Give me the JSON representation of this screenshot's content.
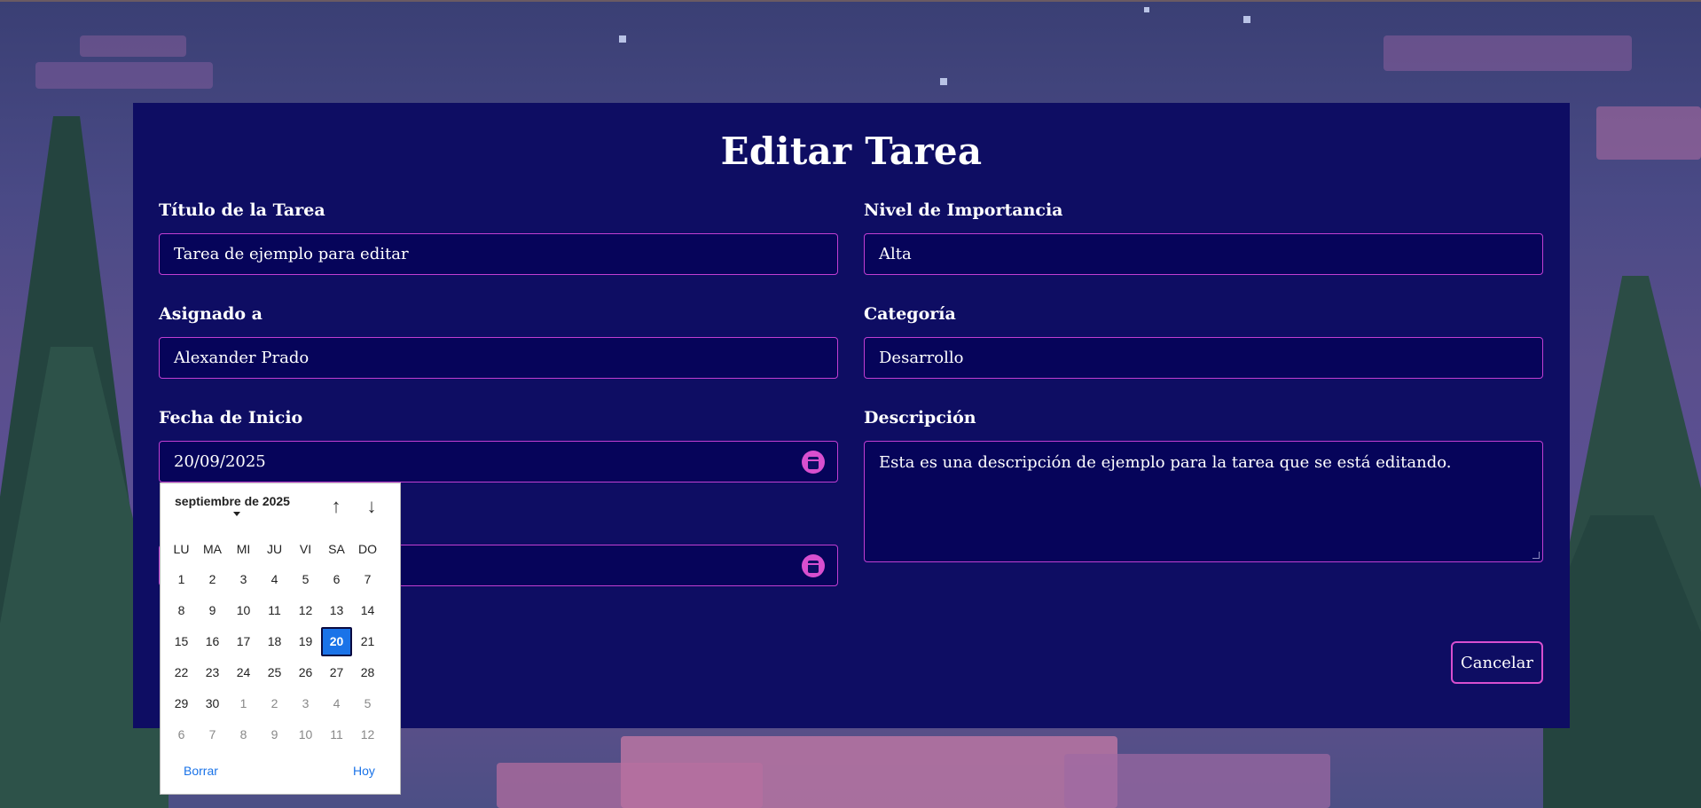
{
  "form": {
    "title": "Editar Tarea",
    "fields": {
      "task_title": {
        "label": "Título de la Tarea",
        "value": "Tarea de ejemplo para editar"
      },
      "importance": {
        "label": "Nivel de Importancia",
        "value": "Alta"
      },
      "assigned_to": {
        "label": "Asignado a",
        "value": "Alexander Prado"
      },
      "category": {
        "label": "Categoría",
        "value": "Desarrollo"
      },
      "start_date": {
        "label": "Fecha de Inicio",
        "value": "20/09/2025"
      },
      "description": {
        "label": "Descripción",
        "value": "Esta es una descripción de ejemplo para la tarea que se está editando."
      }
    },
    "cancel_label": "Cancelar"
  },
  "datepicker": {
    "month_label": "septiembre de 2025",
    "prev_icon": "arrow-up-icon",
    "next_icon": "arrow-down-icon",
    "weekdays": [
      "LU",
      "MA",
      "MI",
      "JU",
      "VI",
      "SA",
      "DO"
    ],
    "selected_day": "20",
    "weeks": [
      [
        "1",
        "2",
        "3",
        "4",
        "5",
        "6",
        "7"
      ],
      [
        "8",
        "9",
        "10",
        "11",
        "12",
        "13",
        "14"
      ],
      [
        "15",
        "16",
        "17",
        "18",
        "19",
        "20",
        "21"
      ],
      [
        "22",
        "23",
        "24",
        "25",
        "26",
        "27",
        "28"
      ],
      [
        "29",
        "30",
        "1",
        "2",
        "3",
        "4",
        "5"
      ],
      [
        "6",
        "7",
        "8",
        "9",
        "10",
        "11",
        "12"
      ]
    ],
    "clear_label": "Borrar",
    "today_label": "Hoy"
  },
  "colors": {
    "panel": "#0e0d63",
    "field_border": "#c13ed2",
    "accent": "#d84fcf",
    "selected_day": "#1a73e8"
  }
}
